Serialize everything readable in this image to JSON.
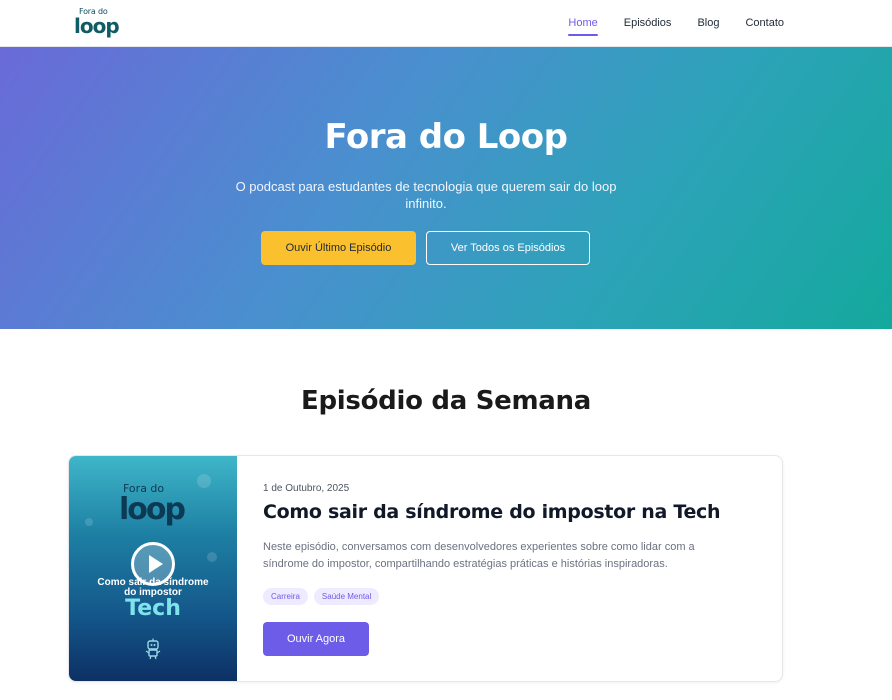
{
  "header": {
    "logo_small": "Fora do",
    "logo_big": "loop",
    "nav": [
      {
        "label": "Home",
        "active": true
      },
      {
        "label": "Episódios",
        "active": false
      },
      {
        "label": "Blog",
        "active": false
      },
      {
        "label": "Contato",
        "active": false
      }
    ]
  },
  "hero": {
    "title": "Fora do Loop",
    "subtitle": "O podcast para estudantes de tecnologia que querem sair do loop infinito.",
    "primary_button": "Ouvir Último Episódio",
    "secondary_button": "Ver Todos os Episódios"
  },
  "section": {
    "title": "Episódio da Semana"
  },
  "episode": {
    "thumbnail": {
      "logo_small": "Fora do",
      "logo_big": "loop",
      "line1": "Como sair da síndrome",
      "line2": "do impostor",
      "line3": "Tech"
    },
    "date": "1 de Outubro, 2025",
    "title": "Como sair da síndrome do impostor na Tech",
    "description": "Neste episódio, conversamos com desenvolvedores experientes sobre como lidar com a síndrome do impostor, compartilhando estratégias práticas e histórias inspiradoras.",
    "tags": [
      "Carreira",
      "Saúde Mental"
    ],
    "button": "Ouvir Agora"
  },
  "colors": {
    "accent": "#6d5ce7",
    "cta_yellow": "#fbc02d",
    "hero_gradient_start": "#6a6ad8",
    "hero_gradient_end": "#14a99d"
  },
  "icons": {
    "play": "play-icon",
    "robot": "robot-icon"
  }
}
